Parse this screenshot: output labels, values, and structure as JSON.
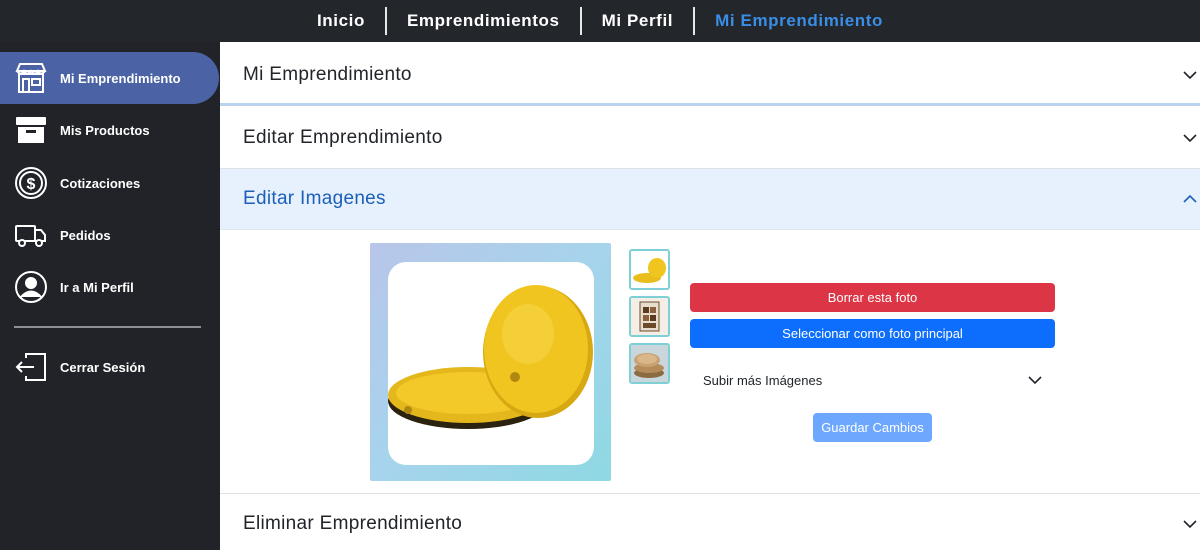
{
  "topnav": {
    "links": [
      {
        "label": "Inicio"
      },
      {
        "label": "Emprendimientos"
      },
      {
        "label": "Mi Perfil"
      },
      {
        "label": "Mi Emprendimiento"
      }
    ],
    "active_index": 3,
    "active_color": "#3a8ee6"
  },
  "sidebar": {
    "items": [
      {
        "label": "Mi Emprendimiento",
        "icon": "store-icon"
      },
      {
        "label": "Mis Productos",
        "icon": "archive-box-icon"
      },
      {
        "label": "Cotizaciones",
        "icon": "dollar-coin-icon"
      },
      {
        "label": "Pedidos",
        "icon": "truck-icon"
      },
      {
        "label": "Ir a Mi Perfil",
        "icon": "user-circle-icon"
      },
      {
        "label": "Cerrar Sesión",
        "icon": "logout-icon"
      }
    ],
    "active_color": "#4b63a5"
  },
  "accordion": {
    "sections": [
      {
        "title": "Mi Emprendimiento",
        "expanded": false
      },
      {
        "title": "Editar Emprendimiento",
        "expanded": false
      },
      {
        "title": "Editar Imagenes",
        "expanded": true
      },
      {
        "title": "Eliminar Emprendimiento",
        "expanded": false
      }
    ]
  },
  "images": {
    "thumbnails": [
      "gold-cake-boards-thumb",
      "chocolate-box-thumb",
      "wood-boards-thumb"
    ],
    "delete_label": "Borrar esta foto",
    "set_main_label": "Seleccionar como foto principal",
    "upload_label": "Subir más Imágenes",
    "save_label": "Guardar Cambios",
    "colors": {
      "danger": "#dc3545",
      "primary": "#0d6efd",
      "save": "#6ea8fe"
    }
  }
}
